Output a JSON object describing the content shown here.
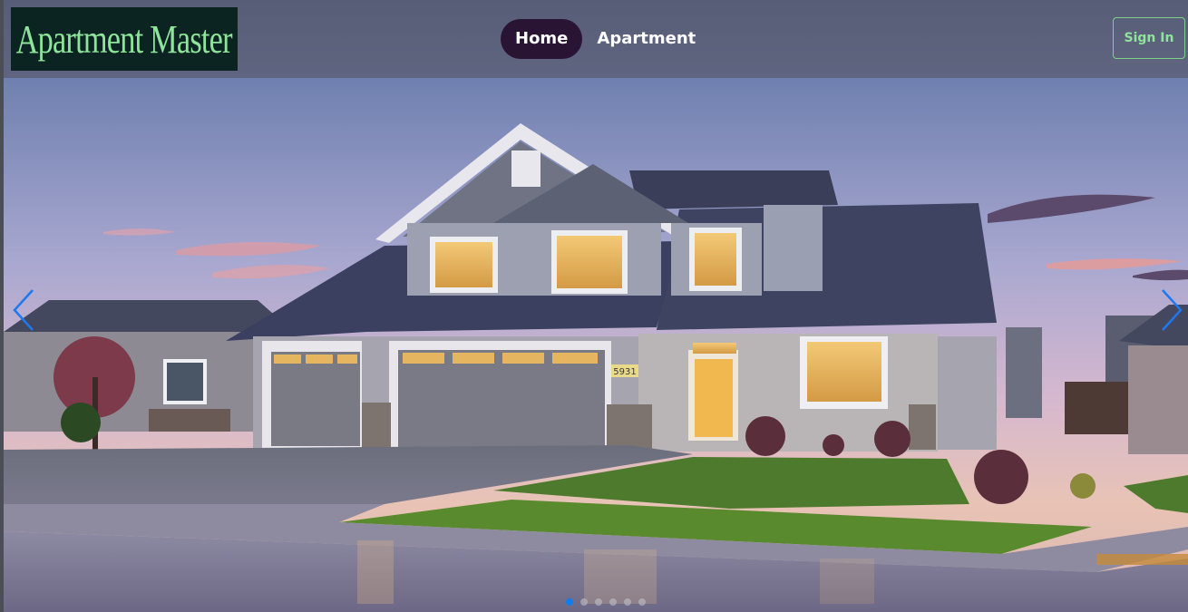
{
  "header": {
    "logo_text": "Apartment Master",
    "nav": [
      {
        "label": "Home",
        "active": true
      },
      {
        "label": "Apartment",
        "active": false
      }
    ],
    "signin_label": "Sign In"
  },
  "hero": {
    "image_description": "Two-story suburban house with three-car garage at dusk",
    "house_number": "5931",
    "slide_count": 6,
    "active_slide": 1
  },
  "colors": {
    "header_bg": "#5c617b",
    "logo_bg": "#0b2422",
    "logo_text": "#8ee49a",
    "nav_active_bg": "#2a1434",
    "signin_border": "#7fd18a",
    "indicator_active": "#0d7ff2",
    "arrow": "#1e78ef"
  }
}
